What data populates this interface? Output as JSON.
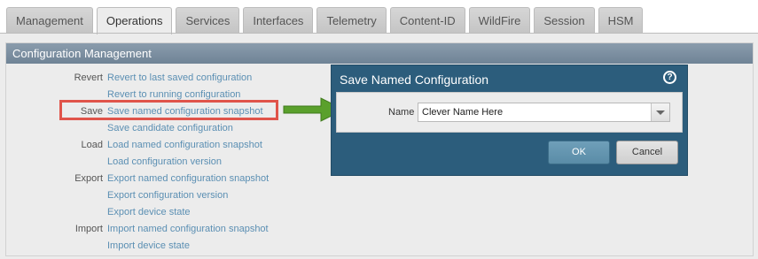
{
  "tabs": [
    {
      "label": "Management",
      "active": false
    },
    {
      "label": "Operations",
      "active": true
    },
    {
      "label": "Services",
      "active": false
    },
    {
      "label": "Interfaces",
      "active": false
    },
    {
      "label": "Telemetry",
      "active": false
    },
    {
      "label": "Content-ID",
      "active": false
    },
    {
      "label": "WildFire",
      "active": false
    },
    {
      "label": "Session",
      "active": false
    },
    {
      "label": "HSM",
      "active": false
    }
  ],
  "panel": {
    "title": "Configuration Management",
    "rows": [
      {
        "label": "Revert",
        "link": "Revert to last saved configuration"
      },
      {
        "label": "",
        "link": "Revert to running configuration"
      },
      {
        "label": "Save",
        "link": "Save named configuration snapshot"
      },
      {
        "label": "",
        "link": "Save candidate configuration"
      },
      {
        "label": "Load",
        "link": "Load named configuration snapshot"
      },
      {
        "label": "",
        "link": "Load configuration version"
      },
      {
        "label": "Export",
        "link": "Export named configuration snapshot"
      },
      {
        "label": "",
        "link": "Export configuration version"
      },
      {
        "label": "",
        "link": "Export device state"
      },
      {
        "label": "Import",
        "link": "Import named configuration snapshot"
      },
      {
        "label": "",
        "link": "Import device state"
      }
    ]
  },
  "dialog": {
    "title": "Save Named Configuration",
    "help_icon": "help-icon",
    "name_label": "Name",
    "name_value": "Clever Name Here",
    "ok_label": "OK",
    "cancel_label": "Cancel"
  },
  "colors": {
    "accent": "#2c5d7c",
    "link": "#5b8fb3",
    "highlight": "#e0544a",
    "arrow": "#5aa02c"
  }
}
